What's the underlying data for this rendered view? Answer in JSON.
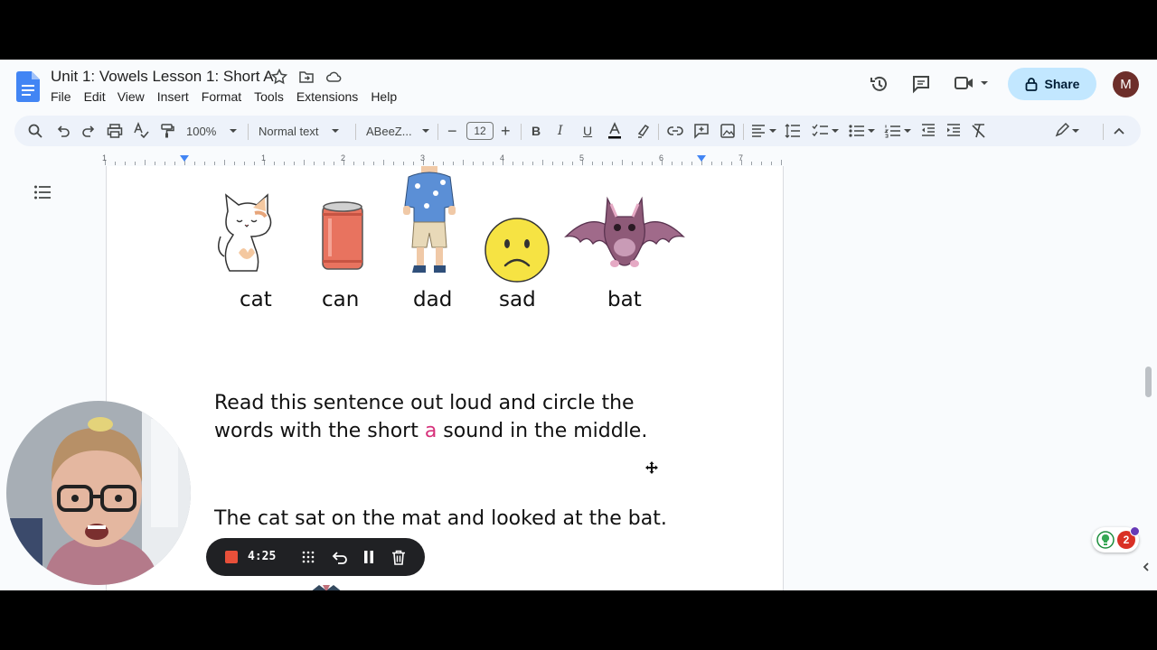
{
  "doc": {
    "title": "Unit 1: Vowels Lesson 1: Short A",
    "menu": [
      "File",
      "Edit",
      "View",
      "Insert",
      "Format",
      "Tools",
      "Extensions",
      "Help"
    ],
    "share_label": "Share",
    "avatar_initial": "M"
  },
  "toolbar": {
    "zoom": "100%",
    "style": "Normal text",
    "font": "ABeeZ...",
    "font_size": "12"
  },
  "ruler": {
    "numbers": [
      "1",
      "1",
      "2",
      "3",
      "4",
      "5",
      "6",
      "7"
    ]
  },
  "content": {
    "words": [
      "cat",
      "can",
      "dad",
      "sad",
      "bat"
    ],
    "instruction_line1": "Read this sentence out loud and circle the",
    "instruction_line2_a": "words with the short ",
    "instruction_highlight": "a",
    "instruction_line2_b": " sound in the middle.",
    "sentence": "The cat sat on the mat and looked at the bat."
  },
  "recorder": {
    "time": "4:25"
  },
  "notifications": {
    "count": "2"
  },
  "colors": {
    "accent": "#c2e7ff",
    "highlight": "#d6307a",
    "rec": "#e8503a"
  }
}
